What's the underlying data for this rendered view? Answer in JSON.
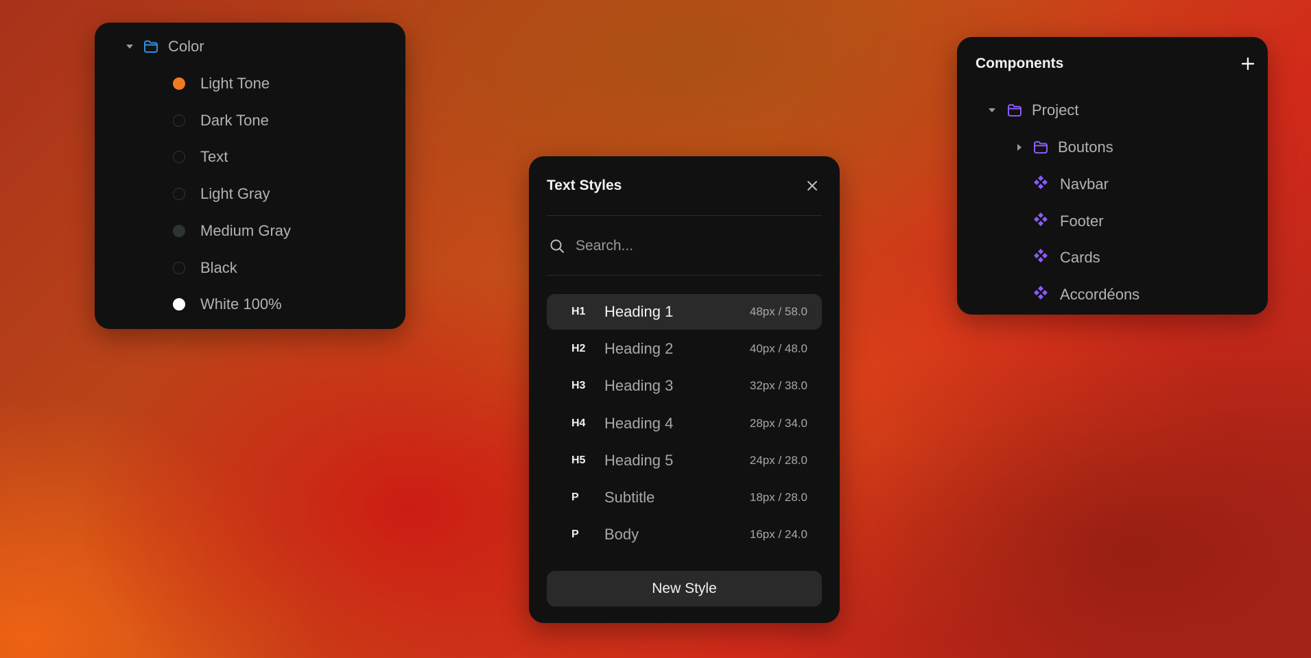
{
  "colors_panel": {
    "folder_label": "Color",
    "items": [
      {
        "label": "Light Tone",
        "color": "#f47a22",
        "filled": true
      },
      {
        "label": "Dark Tone",
        "color": "#111111",
        "filled": false
      },
      {
        "label": "Text",
        "color": "#111111",
        "filled": false
      },
      {
        "label": "Light Gray",
        "color": "#111111",
        "filled": false
      },
      {
        "label": "Medium Gray",
        "color": "#2e3430",
        "filled": true
      },
      {
        "label": "Black",
        "color": "#111111",
        "filled": false
      },
      {
        "label": "White 100%",
        "color": "#ffffff",
        "filled": true
      }
    ]
  },
  "text_styles_panel": {
    "title": "Text Styles",
    "search": {
      "placeholder": "Search...",
      "value": ""
    },
    "styles": [
      {
        "tag": "H1",
        "name": "Heading 1",
        "size": "48px / 58.0",
        "selected": true
      },
      {
        "tag": "H2",
        "name": "Heading 2",
        "size": "40px / 48.0",
        "selected": false
      },
      {
        "tag": "H3",
        "name": "Heading 3",
        "size": "32px / 38.0",
        "selected": false
      },
      {
        "tag": "H4",
        "name": "Heading 4",
        "size": "28px / 34.0",
        "selected": false
      },
      {
        "tag": "H5",
        "name": "Heading 5",
        "size": "24px / 28.0",
        "selected": false
      },
      {
        "tag": "P",
        "name": "Subtitle",
        "size": "18px / 28.0",
        "selected": false
      },
      {
        "tag": "P",
        "name": "Body",
        "size": "16px / 24.0",
        "selected": false
      }
    ],
    "new_style_label": "New Style"
  },
  "components_panel": {
    "title": "Components",
    "project_label": "Project",
    "subfolder_label": "Boutons",
    "items": [
      "Navbar",
      "Footer",
      "Cards",
      "Accordéons"
    ]
  },
  "colors": {
    "folder_blue": "#2f8fe6",
    "component_purple": "#8b5cf6",
    "panel_bg": "#111111"
  }
}
